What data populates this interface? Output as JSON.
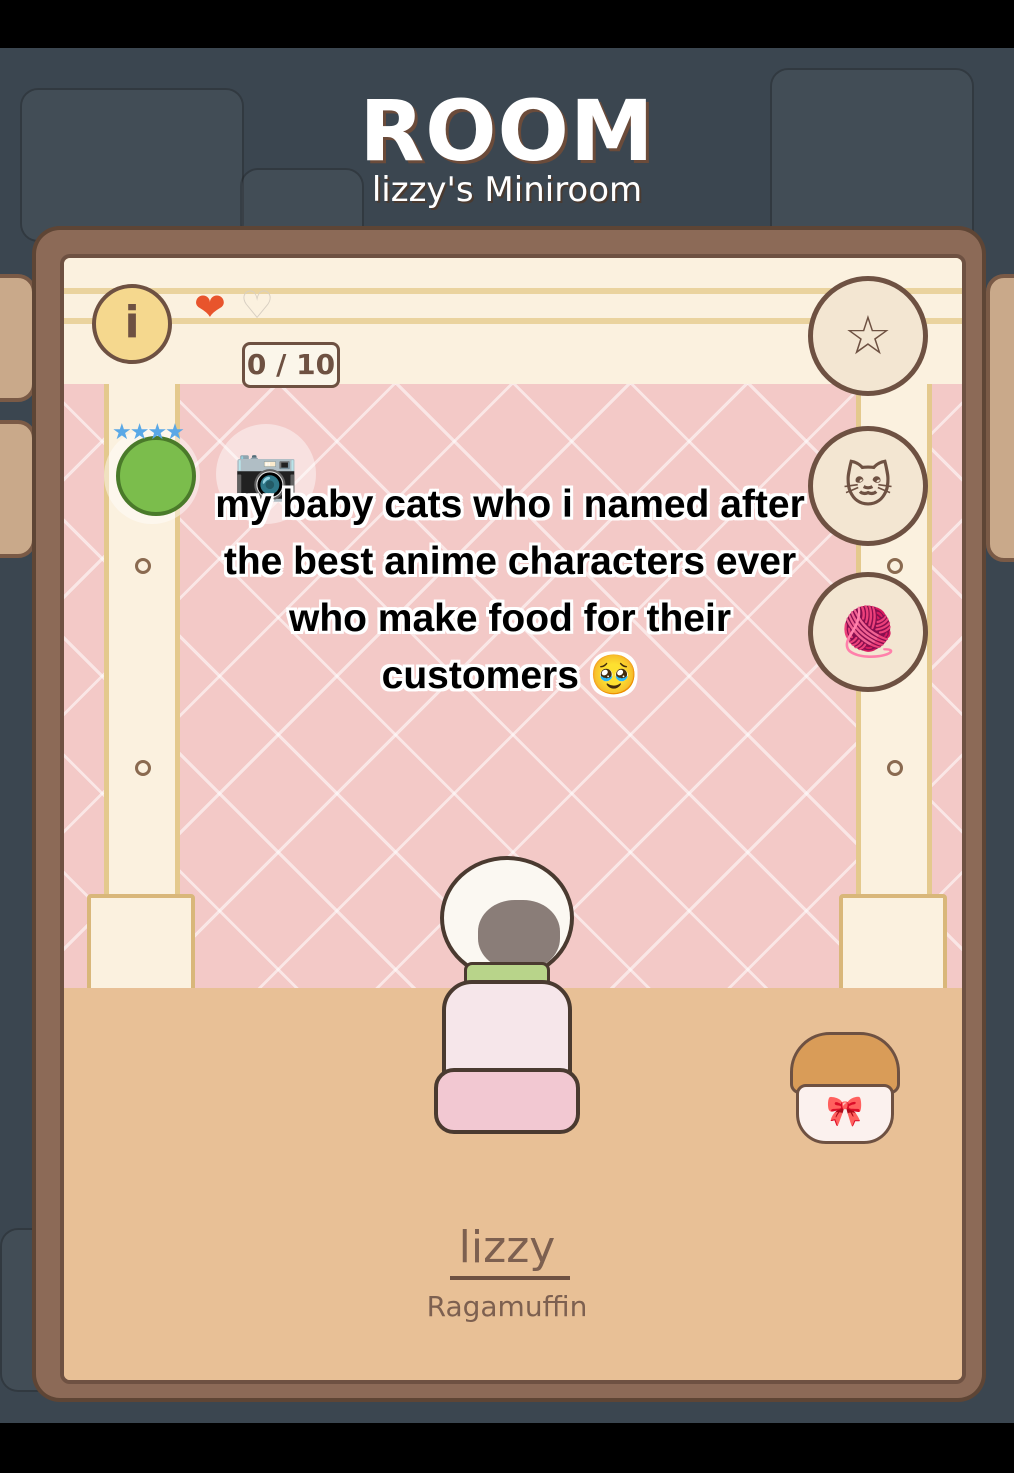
{
  "header": {
    "title": "ROOM",
    "subtitle": "lizzy's Miniroom"
  },
  "hearts": {
    "counter": "0 / 10",
    "filled_icon": "❤",
    "empty_icon": "♡"
  },
  "buttons": {
    "info_icon": "i",
    "bookmark_icon": "☆",
    "swap_cats_icon": "🐱",
    "yarn_icon": "🧶",
    "camera_icon": "📷",
    "rating_stars": "★★★★"
  },
  "caption": {
    "text": "my baby cats who i named after the best anime characters ever who make food for their customers 🥹"
  },
  "cat": {
    "name": "lizzy",
    "breed": "Ragamuffin"
  },
  "colors": {
    "frame": "#8c6a57",
    "wall": "#f3c9c7",
    "floor": "#e8c096",
    "heart_filled": "#e8542c"
  }
}
